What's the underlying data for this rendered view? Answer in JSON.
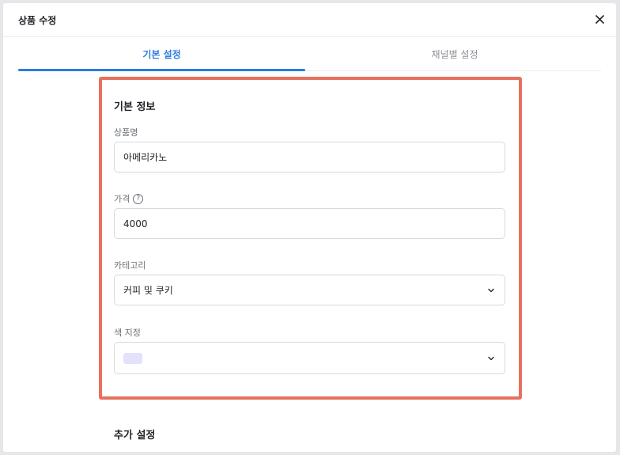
{
  "modal": {
    "title": "상품 수정",
    "close_icon": "close-icon"
  },
  "tabs": [
    {
      "label": "기본 설정",
      "active": true
    },
    {
      "label": "채널별 설정",
      "active": false
    }
  ],
  "basic_info": {
    "section_title": "기본 정보",
    "product_name": {
      "label": "상품명",
      "value": "아메리카노"
    },
    "price": {
      "label": "가격",
      "value": "4000",
      "help_icon": "question-circle-icon"
    },
    "category": {
      "label": "카테고리",
      "value": "커피 및 쿠키",
      "icon": "chevron-down-icon"
    },
    "color": {
      "label": "색 지정",
      "swatch_color": "#e3e1fb",
      "icon": "chevron-down-icon"
    }
  },
  "additional": {
    "section_title": "추가 설정"
  },
  "colors": {
    "accent": "#2b7de0",
    "highlight_border": "#e6715f"
  }
}
